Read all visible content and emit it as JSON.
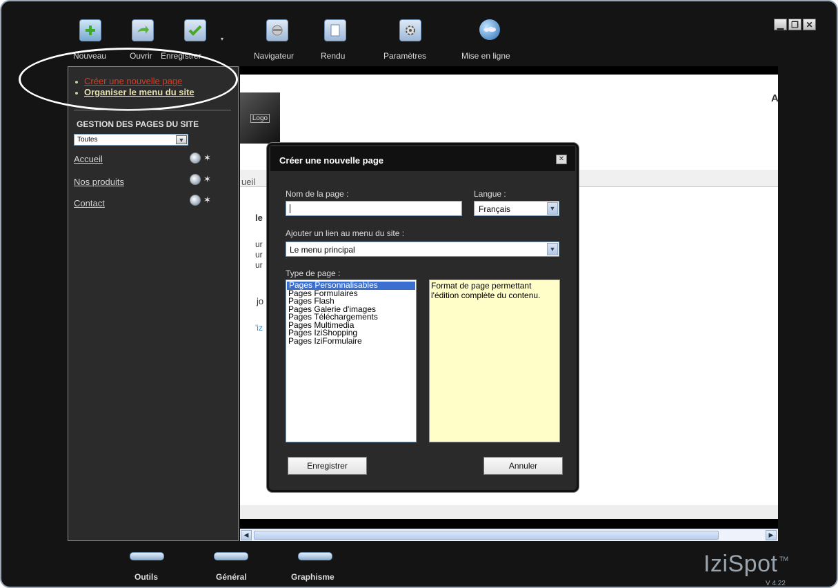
{
  "toolbar": {
    "items": [
      {
        "label": "Nouveau",
        "icon": "plus-icon"
      },
      {
        "label": "Ouvrir",
        "icon": "arrow-icon"
      },
      {
        "label": "Enregistrer",
        "icon": "check-icon"
      },
      {
        "label": "Navigateur",
        "icon": "browser-icon"
      },
      {
        "label": "Rendu",
        "icon": "page-icon"
      },
      {
        "label": "Paramètres",
        "icon": "gear-icon"
      },
      {
        "label": "Mise en ligne",
        "icon": "globe-icon"
      }
    ]
  },
  "sidebar": {
    "actions": [
      "Créer une nouvelle page",
      "Organiser le menu du site"
    ],
    "section_title": "GESTION DES PAGES DU SITE",
    "filter_value": "Toutes",
    "pages": [
      "Accueil",
      "Nos produits",
      "Contact"
    ]
  },
  "preview": {
    "tab_fragment": "ueil",
    "logo_text": "Logo",
    "corner_text": "A",
    "fragments": [
      "le",
      "ur",
      "ur",
      "ur",
      "jo",
      "'iz"
    ]
  },
  "dialog": {
    "title": "Créer une nouvelle page",
    "name_label": "Nom de la page :",
    "name_value": "",
    "lang_label": "Langue :",
    "lang_value": "Français",
    "menu_label": "Ajouter un lien au menu du site :",
    "menu_value": "Le menu principal",
    "type_label": "Type de page :",
    "types": [
      "Pages Personnalisables",
      "Pages Formulaires",
      "Pages Flash",
      "Pages Galerie d'images",
      "Pages Téléchargements",
      "Pages Multimedia",
      "Pages IziShopping",
      "Pages IziFormulaire"
    ],
    "selected_type_index": 0,
    "description": "Format de page permettant l'édition complète du contenu.",
    "save_label": "Enregistrer",
    "cancel_label": "Annuler"
  },
  "bottom_tabs": [
    "Outils",
    "Général",
    "Graphisme"
  ],
  "brand": {
    "name": "IziSpot",
    "tm": "TM",
    "version": "V 4.22"
  },
  "colors": {
    "sidebar_bg": "#2b2b2b",
    "link_active": "#e03a1e",
    "link": "#e8e0b0",
    "selection": "#3a6fd0",
    "description_bg": "#fffec8"
  }
}
